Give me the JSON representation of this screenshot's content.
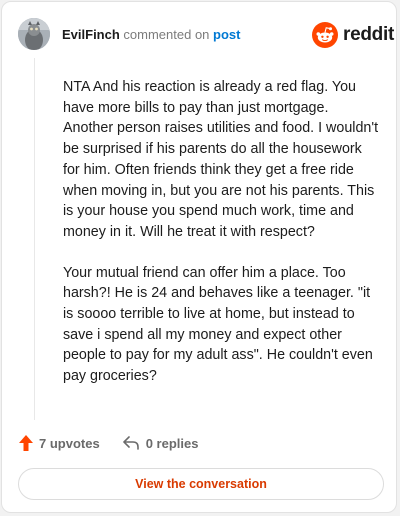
{
  "comment": {
    "author": "EvilFinch",
    "action_text": "commented on",
    "post_link_label": "post",
    "paragraphs": [
      "NTA And his reaction is already a red flag. You have more bills to pay than just mortgage. Another person raises utilities and food. I wouldn't be surprised if his parents do all the housework for him. Often friends think they get a free ride when moving in, but you are not his parents. This is your house you spend much work, time and money in it. Will he treat it with respect?",
      "Your mutual friend can offer him a place. Too harsh?! He is 24 and behaves like a teenager. \"it is soooo terrible to live at home, but instead to save i spend all my money and expect other people to pay for my adult ass\". He couldn't even pay groceries?"
    ],
    "upvotes": "7 upvotes",
    "replies": "0 replies"
  },
  "brand": {
    "name": "reddit",
    "icon": "reddit-snoo-icon"
  },
  "view_button_label": "View the conversation",
  "colors": {
    "brand_orange": "#ff4500",
    "link_blue": "#0079d3",
    "button_text": "#d93a00",
    "upvote_orange": "#ff4500"
  }
}
